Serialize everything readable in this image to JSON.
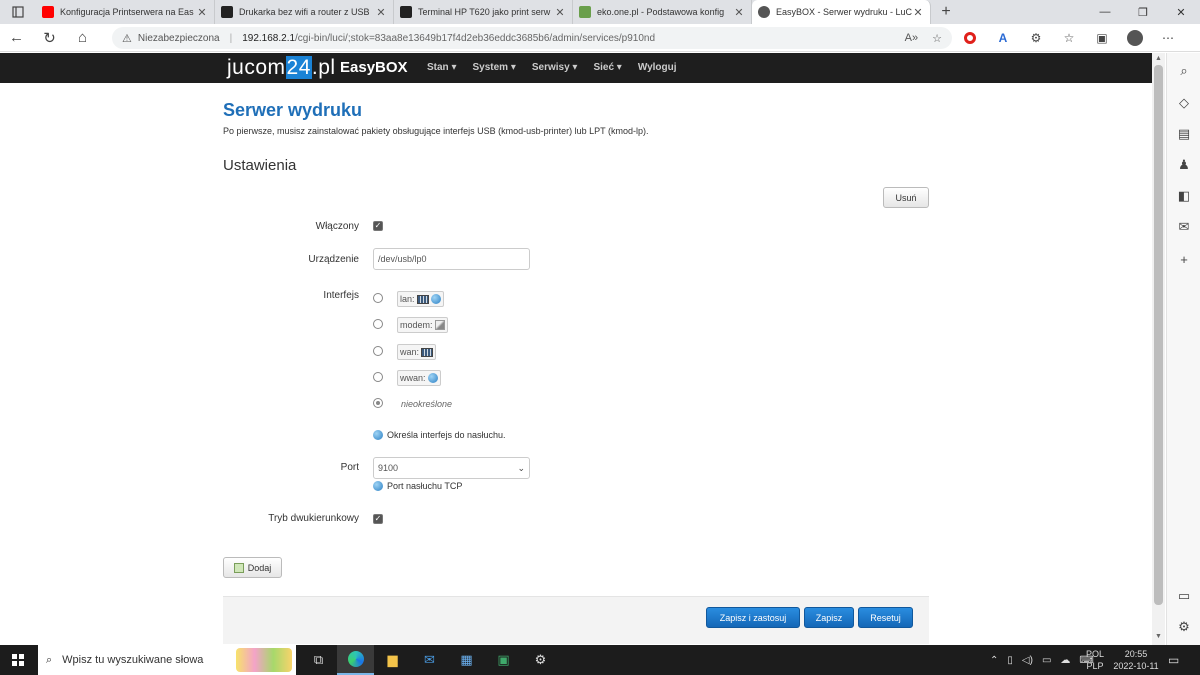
{
  "browser": {
    "tabs": [
      {
        "label": "Konfiguracja Printserwera na Eas",
        "icon": "youtube-icon",
        "color": "#ff0000"
      },
      {
        "label": "Drukarka bez wifi a router z USB",
        "icon": "site-icon",
        "color": "#222222"
      },
      {
        "label": "Terminal HP T620 jako print serw",
        "icon": "site-icon",
        "color": "#222222"
      },
      {
        "label": "eko.one.pl - Podstawowa konfig",
        "icon": "forum-icon",
        "color": "#6a9f4c"
      },
      {
        "label": "EasyBOX - Serwer wydruku - LuC",
        "icon": "luci-icon",
        "color": "#555555"
      }
    ],
    "insecure_label": "Niezabezpieczona",
    "url_host": "192.168.2.1",
    "url_path": "/cgi-bin/luci/;stok=83aa8e13649b17f4d2eb36eddc3685b6/admin/services/p910nd"
  },
  "site": {
    "logo_pre": "jucom",
    "logo_hl": "24",
    "logo_post": ".pl",
    "brand": "EasyBOX",
    "nav": [
      "Stan ▾",
      "System ▾",
      "Serwisy ▾",
      "Sieć ▾",
      "Wyloguj"
    ]
  },
  "page": {
    "title": "Serwer wydruku",
    "description": "Po pierwsze, musisz zainstalować pakiety obsługujące interfejs USB (kmod-usb-printer) lub LPT (kmod-lp).",
    "section": "Ustawienia",
    "delete_label": "Usuń",
    "enabled_label": "Włączony",
    "enabled_checked": "✓",
    "device_label": "Urządzenie",
    "device_value": "/dev/usb/lp0",
    "interface_label": "Interfejs",
    "interfaces": [
      "lan:",
      "modem:",
      "wan:",
      "wwan:"
    ],
    "unspecified": "nieokreślone",
    "interface_hint": "Określa interfejs do nasłuchu.",
    "port_label": "Port",
    "port_value": "9100",
    "port_hint": "Port nasłuchu TCP",
    "bidir_label": "Tryb dwukierunkowy",
    "bidir_checked": "✓",
    "add_label": "Dodaj",
    "save_apply_label": "Zapisz i zastosuj",
    "save_label": "Zapisz",
    "reset_label": "Resetuj"
  },
  "taskbar": {
    "search_placeholder": "Wpisz tu wyszukiwane słowa",
    "lang1": "POL",
    "lang2": "PLP",
    "time": "20:55",
    "date": "2022-10-11"
  }
}
